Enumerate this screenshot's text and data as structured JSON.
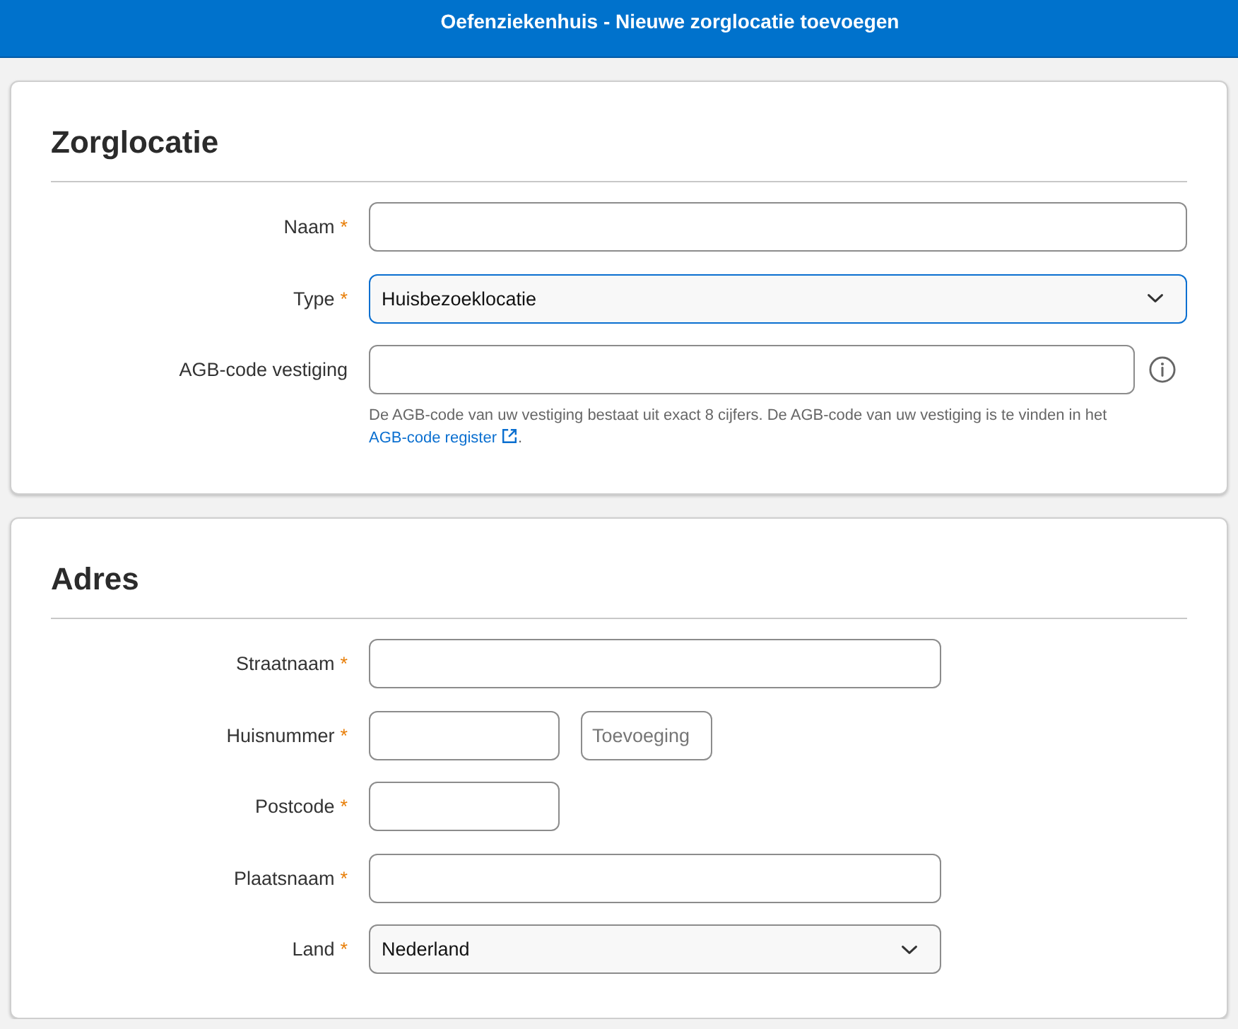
{
  "window": {
    "title": "Oefenziekenhuis - Nieuwe zorglocatie toevoegen"
  },
  "sections": [
    {
      "title": "Zorglocatie",
      "fields": [
        {
          "label": "Naam",
          "required_mark": "*",
          "inputs": [
            {
              "kind": "text",
              "focused": false
            }
          ]
        },
        {
          "label": "Type",
          "required_mark": "*",
          "inputs": [
            {
              "kind": "select",
              "value": "Huisbezoeklocatie",
              "focused": true
            }
          ]
        },
        {
          "label": "AGB-code vestiging",
          "inputs": [
            {
              "kind": "text",
              "focused": false
            }
          ],
          "info_button": true,
          "hint": {
            "text": "De AGB-code van uw vestiging bestaat uit exact 8 cijfers. De AGB-code van uw vestiging is te vinden in het",
            "link": "AGB-code register",
            "after": "."
          }
        }
      ]
    },
    {
      "title": "Adres",
      "fields": [
        {
          "label": "Straatnaam",
          "required_mark": "*",
          "inputs": [
            {
              "kind": "text",
              "focused": false
            }
          ]
        },
        {
          "label": "Huisnummer",
          "required_mark": "*",
          "inputs": [
            {
              "kind": "text",
              "focused": false
            },
            {
              "kind": "text",
              "placeholder": "Toevoeging",
              "focused": false
            }
          ]
        },
        {
          "label": "Postcode",
          "required_mark": "*",
          "inputs": [
            {
              "kind": "text",
              "focused": false
            }
          ]
        },
        {
          "label": "Plaatsnaam",
          "required_mark": "*",
          "inputs": [
            {
              "kind": "text",
              "focused": false
            }
          ]
        },
        {
          "label": "Land",
          "required_mark": "*",
          "inputs": [
            {
              "kind": "select",
              "value": "Nederland",
              "focused": false
            }
          ]
        }
      ]
    }
  ]
}
